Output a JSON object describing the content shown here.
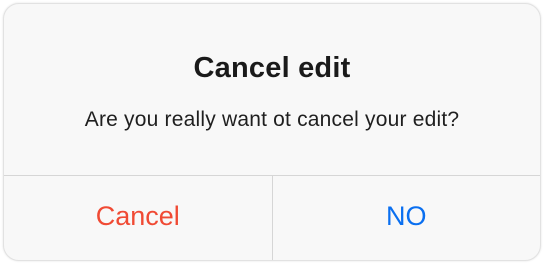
{
  "dialog": {
    "title": "Cancel edit",
    "message": "Are you really want ot cancel your edit?",
    "buttons": {
      "cancel_label": "Cancel",
      "no_label": "NO"
    },
    "colors": {
      "cancel_button": "#f04a34",
      "no_button": "#0a6ff0"
    }
  }
}
